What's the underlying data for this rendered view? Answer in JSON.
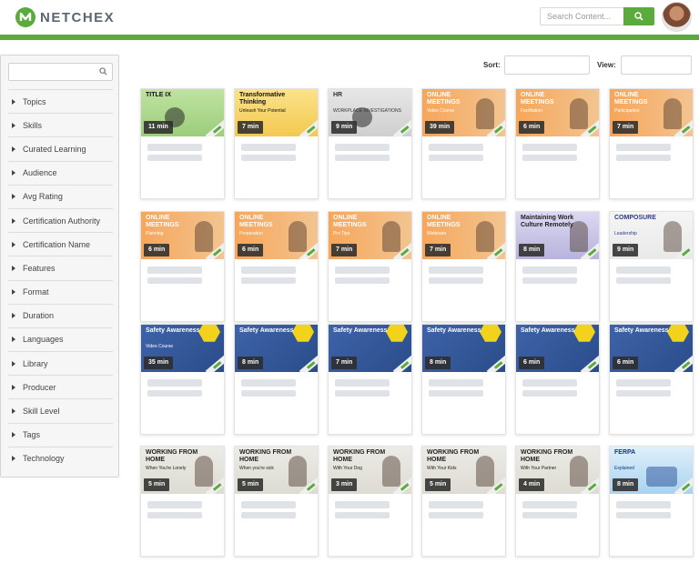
{
  "header": {
    "brand": "NETCHEX",
    "search_placeholder": "Search Content...",
    "colors": {
      "brand_green": "#5aab3c",
      "logo_text": "#5b6770"
    }
  },
  "sidebar": {
    "filters": [
      "Topics",
      "Skills",
      "Curated Learning",
      "Audience",
      "Avg Rating",
      "Certification Authority",
      "Certification Name",
      "Features",
      "Format",
      "Duration",
      "Languages",
      "Library",
      "Producer",
      "Skill Level",
      "Tags",
      "Technology"
    ]
  },
  "toolbar": {
    "sort_label": "Sort:",
    "view_label": "View:"
  },
  "courses": [
    {
      "title": "TITLE IX",
      "subtitle": "",
      "duration": "11 min",
      "theme": "green"
    },
    {
      "title": "Transformative Thinking",
      "subtitle": "Unleash Your Potential",
      "duration": "7 min",
      "theme": "yellow"
    },
    {
      "title": "HR",
      "subtitle": "WORKPLACE INVESTIGATIONS",
      "duration": "9 min",
      "theme": "gray"
    },
    {
      "title": "ONLINE MEETINGS",
      "subtitle": "Video Course",
      "duration": "39 min",
      "theme": "orange"
    },
    {
      "title": "ONLINE MEETINGS",
      "subtitle": "Facilitation",
      "duration": "6 min",
      "theme": "orange"
    },
    {
      "title": "ONLINE MEETINGS",
      "subtitle": "Participation",
      "duration": "7 min",
      "theme": "orange"
    },
    {
      "title": "ONLINE MEETINGS",
      "subtitle": "Planning",
      "duration": "6 min",
      "theme": "orange"
    },
    {
      "title": "ONLINE MEETINGS",
      "subtitle": "Preparation",
      "duration": "6 min",
      "theme": "orange"
    },
    {
      "title": "ONLINE MEETINGS",
      "subtitle": "Pro Tips",
      "duration": "7 min",
      "theme": "orange"
    },
    {
      "title": "ONLINE MEETINGS",
      "subtitle": "Webinars",
      "duration": "7 min",
      "theme": "orange"
    },
    {
      "title": "Maintaining Work Culture Remotely",
      "subtitle": "",
      "duration": "8 min",
      "theme": "lavender"
    },
    {
      "title": "COMPOSURE",
      "subtitle": "Leadership",
      "duration": "9 min",
      "theme": "white"
    },
    {
      "title": "Safety Awareness",
      "subtitle": "Video Course",
      "duration": "35 min",
      "theme": "blue"
    },
    {
      "title": "Safety Awareness",
      "subtitle": "",
      "duration": "8 min",
      "theme": "blue"
    },
    {
      "title": "Safety Awareness",
      "subtitle": "",
      "duration": "7 min",
      "theme": "blue"
    },
    {
      "title": "Safety Awareness",
      "subtitle": "",
      "duration": "8 min",
      "theme": "blue"
    },
    {
      "title": "Safety Awareness",
      "subtitle": "",
      "duration": "6 min",
      "theme": "blue"
    },
    {
      "title": "Safety Awareness",
      "subtitle": "",
      "duration": "6 min",
      "theme": "blue"
    },
    {
      "title": "WORKING FROM HOME",
      "subtitle": "When You're Lonely",
      "duration": "5 min",
      "theme": "beige"
    },
    {
      "title": "WORKING FROM HOME",
      "subtitle": "When you're sick",
      "duration": "5 min",
      "theme": "beige"
    },
    {
      "title": "WORKING FROM HOME",
      "subtitle": "With Your Dog",
      "duration": "3 min",
      "theme": "beige"
    },
    {
      "title": "WORKING FROM HOME",
      "subtitle": "With Your Kids",
      "duration": "5 min",
      "theme": "beige"
    },
    {
      "title": "WORKING FROM HOME",
      "subtitle": "With Your Partner",
      "duration": "4 min",
      "theme": "beige"
    },
    {
      "title": "FERPA",
      "subtitle": "Explained",
      "duration": "8 min",
      "theme": "ferpa"
    }
  ]
}
